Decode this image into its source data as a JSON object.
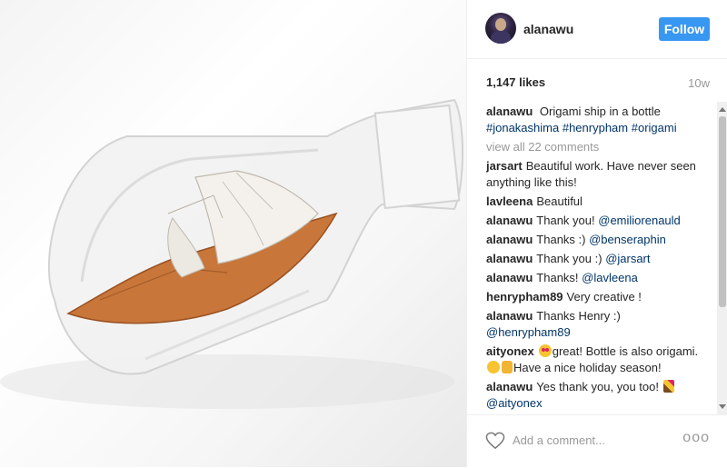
{
  "header": {
    "username": "alanawu",
    "follow_label": "Follow"
  },
  "meta": {
    "likes": "1,147 likes",
    "time": "10w"
  },
  "caption": {
    "user": "alanawu",
    "text": "Origami ship in a bottle",
    "tags": [
      "#jonakashima",
      "#henrypham",
      "#origami"
    ]
  },
  "view_all_label": "view all 22 comments",
  "comments": [
    {
      "user": "jarsart",
      "text": "Beautiful work. Have never seen anything like this!"
    },
    {
      "user": "lavleena",
      "text": "Beautiful"
    },
    {
      "user": "alanawu",
      "text": "Thank you!",
      "mention": "@emiliorenauld"
    },
    {
      "user": "alanawu",
      "text": "Thanks :)",
      "mention": "@benseraphin"
    },
    {
      "user": "alanawu",
      "text": "Thank you :)",
      "mention": "@jarsart"
    },
    {
      "user": "alanawu",
      "text": "Thanks!",
      "mention": "@lavleena"
    },
    {
      "user": "henrypham89",
      "text": "Very creative !"
    },
    {
      "user": "alanawu",
      "text": "Thanks Henry :)",
      "mention": "@henrypham89"
    },
    {
      "user": "aityonex",
      "text_a": "great! Bottle is also origami.",
      "text_b": "Have a nice holiday season!"
    },
    {
      "user": "alanawu",
      "text": "Yes thank you, you too!",
      "mention": "@aityonex"
    }
  ],
  "footer": {
    "comment_placeholder": "Add a comment...",
    "more_label": "ooo"
  },
  "icons": {
    "like": "heart-outline-icon",
    "scroll_up": "scroll-up-arrow-icon",
    "scroll_down": "scroll-down-arrow-icon"
  },
  "colors": {
    "follow_button": "#3897f0",
    "link": "#003569",
    "muted": "#999999",
    "paper_orange": "#c8763a"
  }
}
